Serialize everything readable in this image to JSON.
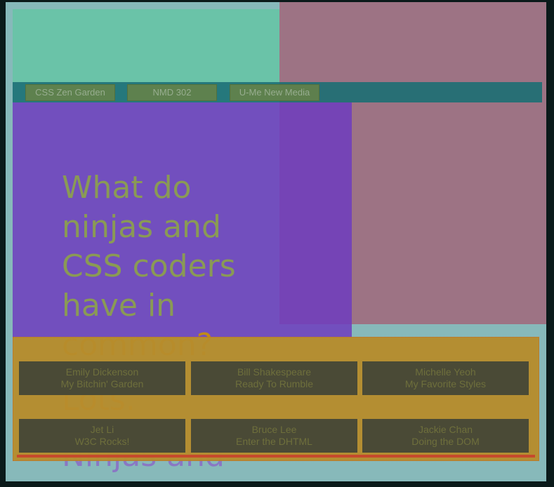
{
  "nav": {
    "items": [
      {
        "label": "CSS Zen Garden"
      },
      {
        "label": "NMD 302"
      },
      {
        "label": "U-Me New Media"
      }
    ]
  },
  "headline": {
    "lines": [
      "What do",
      "ninjas and",
      "CSS coders",
      "have in"
    ],
    "last_line": "common?"
  },
  "subhead": {
    "text": "Lots",
    "period": "."
  },
  "paragraph": {
    "text": "Ninjas and"
  },
  "footer": {
    "cards": [
      {
        "name": "Emily Dickenson",
        "title": "My Bitchin' Garden"
      },
      {
        "name": "Bill Shakespeare",
        "title": "Ready To Rumble"
      },
      {
        "name": "Michelle Yeoh",
        "title": "My Favorite Styles"
      },
      {
        "name": "Jet Li",
        "title": "W3C Rocks!"
      },
      {
        "name": "Bruce Lee",
        "title": "Enter the DHTML"
      },
      {
        "name": "Jackie Chan",
        "title": "Doing the DOM"
      }
    ]
  },
  "colors": {
    "page_bg": "#0b1a1a",
    "frame": "#87b9ba",
    "header_block": "#6ac3a8",
    "pink_panel": "#9d7384",
    "nav_bar": "#186e73",
    "purple_panel": "#6e3cbe",
    "footer": "#b68c2d",
    "footer_line": "#c64a2c",
    "headline_text": "#8a9a55"
  }
}
